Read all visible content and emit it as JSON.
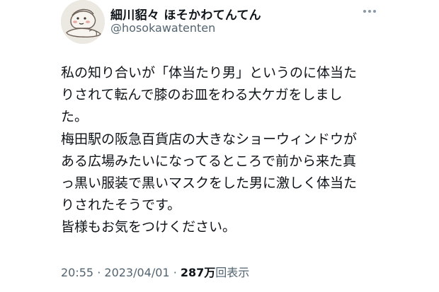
{
  "author": {
    "display_name": "細川貂々 ほそかわてんてん",
    "handle": "@hosokawatenten",
    "avatar_icon": "illustrated-avatar"
  },
  "tweet": {
    "lines": [
      "私の知り合いが「体当たり男」というのに体当た",
      "りされて転んで膝のお皿をわる大ケガをしまし",
      "た。",
      "梅田駅の阪急百貨店の大きなショーウィンドウが",
      "ある広場みたいになってるところで前から来た真",
      "っ黒い服装で黒いマスクをした男に激しく体当た",
      "りされたそうです。",
      "皆様もお気をつけください。"
    ]
  },
  "meta": {
    "time": "20:55",
    "separator": "·",
    "date": "2023/04/01",
    "view_count": "287万",
    "view_label": "回表示"
  },
  "colors": {
    "text": "#0f1419",
    "secondary": "#536471"
  }
}
